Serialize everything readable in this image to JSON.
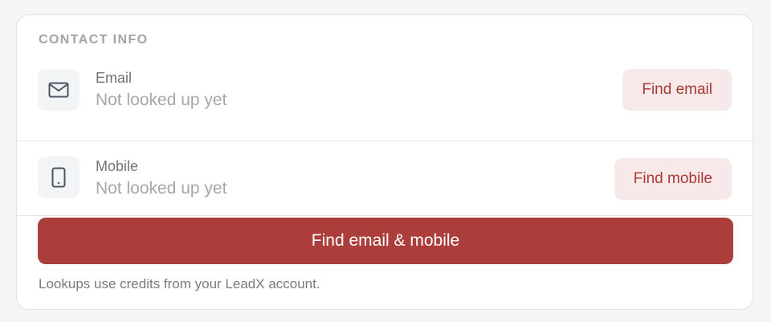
{
  "contact_info": {
    "title": "CONTACT INFO",
    "email": {
      "icon": "mail-icon",
      "label": "Email",
      "value": "Not looked up yet",
      "button_label": "Find email"
    },
    "mobile": {
      "icon": "phone-icon",
      "label": "Mobile",
      "value": "Not looked up yet",
      "button_label": "Find mobile"
    },
    "primary_button_label": "Find email & mobile",
    "footnote": "Lookups use credits from your LeadX account."
  },
  "colors": {
    "accent": "#ab3e3b",
    "accent_light": "#f7e9e9",
    "accent_text": "#a83a36"
  }
}
